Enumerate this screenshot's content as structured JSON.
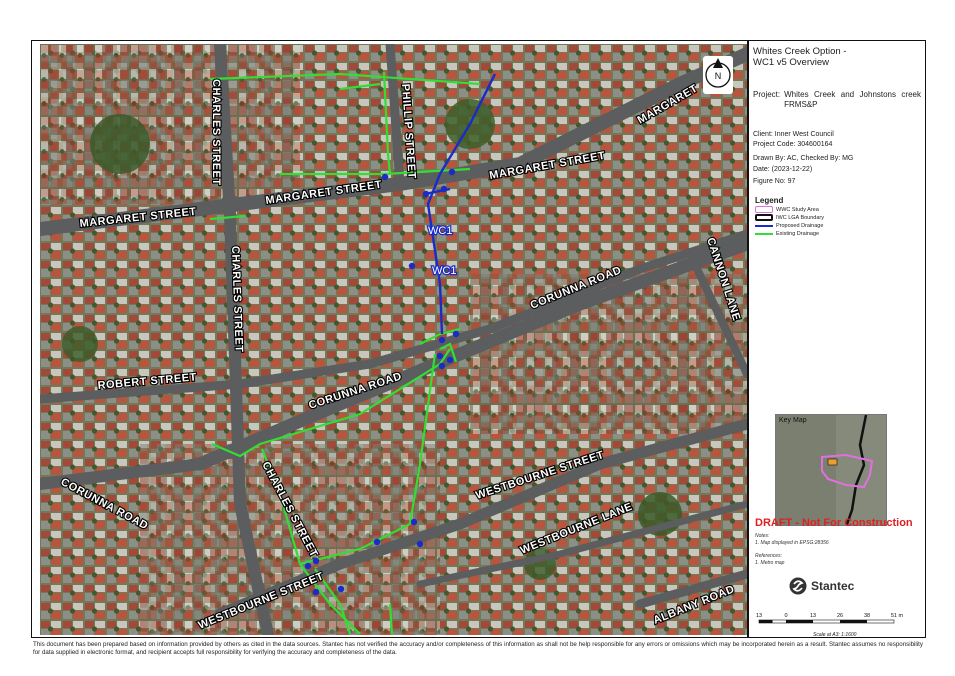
{
  "title": "Whites Creek Option -\nWC1 v5 Overview",
  "project": {
    "label": "Project:",
    "value": "Whites Creek and Johnstons creek FRMS&P"
  },
  "meta": [
    "Client:  Inner West Council",
    "Project Code:  304600164",
    "Drawn By:  AC, Checked By: MG",
    "Date:  (2023-12-22)",
    "Figure No:  97"
  ],
  "legend": {
    "title": "Legend",
    "items": [
      {
        "label": "WWC Study Area",
        "color": "#e070e0",
        "kind": "box-pink"
      },
      {
        "label": "IWC LGA Boundary",
        "color": "#111111",
        "kind": "box-black"
      },
      {
        "label": "Proposed Drainage",
        "color": "#1a2bc8",
        "kind": "line"
      },
      {
        "label": "Existing Drainage",
        "color": "#33dd33",
        "kind": "line"
      }
    ]
  },
  "key_map": {
    "label": "Key Map"
  },
  "draft": "DRAFT - Not For Construction",
  "notes": {
    "heading": "Notes:",
    "text": "1. Map displayed in EPSG:28356"
  },
  "references": {
    "heading": "References:",
    "text": "1. Metro map"
  },
  "logo": {
    "name": "Stantec",
    "icon": "stantec-swirl-icon"
  },
  "scale": {
    "ticks": [
      "13",
      "0",
      "13",
      "26",
      "38",
      "51 m"
    ],
    "caption": "Scale at A3: 1:1600"
  },
  "north": {
    "label": "N"
  },
  "disclaimer": "This document has been prepared based on information provided by others as cited in the data sources. Stantec has not verified the accuracy and/or completeness of this information as shall not be help responsible for any errors or omissions which may be incorporated herein as a result. Stantec assumes no responsibility for data supplied in electronic format, and recipient accepts full responsibility for verifying the accuracy and completeness of the data.",
  "map_labels": {
    "charles_street_north": "CHARLES STREET",
    "phillip_street": "PHILLIP STREET",
    "margaret_east": "MARGARET",
    "margaret_street_mid": "MARGARET STREET",
    "margaret_street_right": "MARGARET STREET",
    "margaret_street_left": "MARGARET STREET",
    "wc1_upper": "WC1",
    "wc1_lower": "WC1",
    "charles_street_mid": "CHARLES STREET",
    "corunna_road_right": "CORUNNA ROAD",
    "cannon_lane": "CANNON LANE",
    "robert_street": "ROBERT STREET",
    "corunna_road_mid": "CORUNNA ROAD",
    "corunna_road_left": "CORUNNA ROAD",
    "westbourne_street_right": "WESTBOURNE STREET",
    "charles_street_south": "CHARLES STREET",
    "westbourne_lane": "WESTBOURNE LANE",
    "westbourne_street_left": "WESTBOURNE STREET",
    "albany_road": "ALBANY ROAD"
  }
}
